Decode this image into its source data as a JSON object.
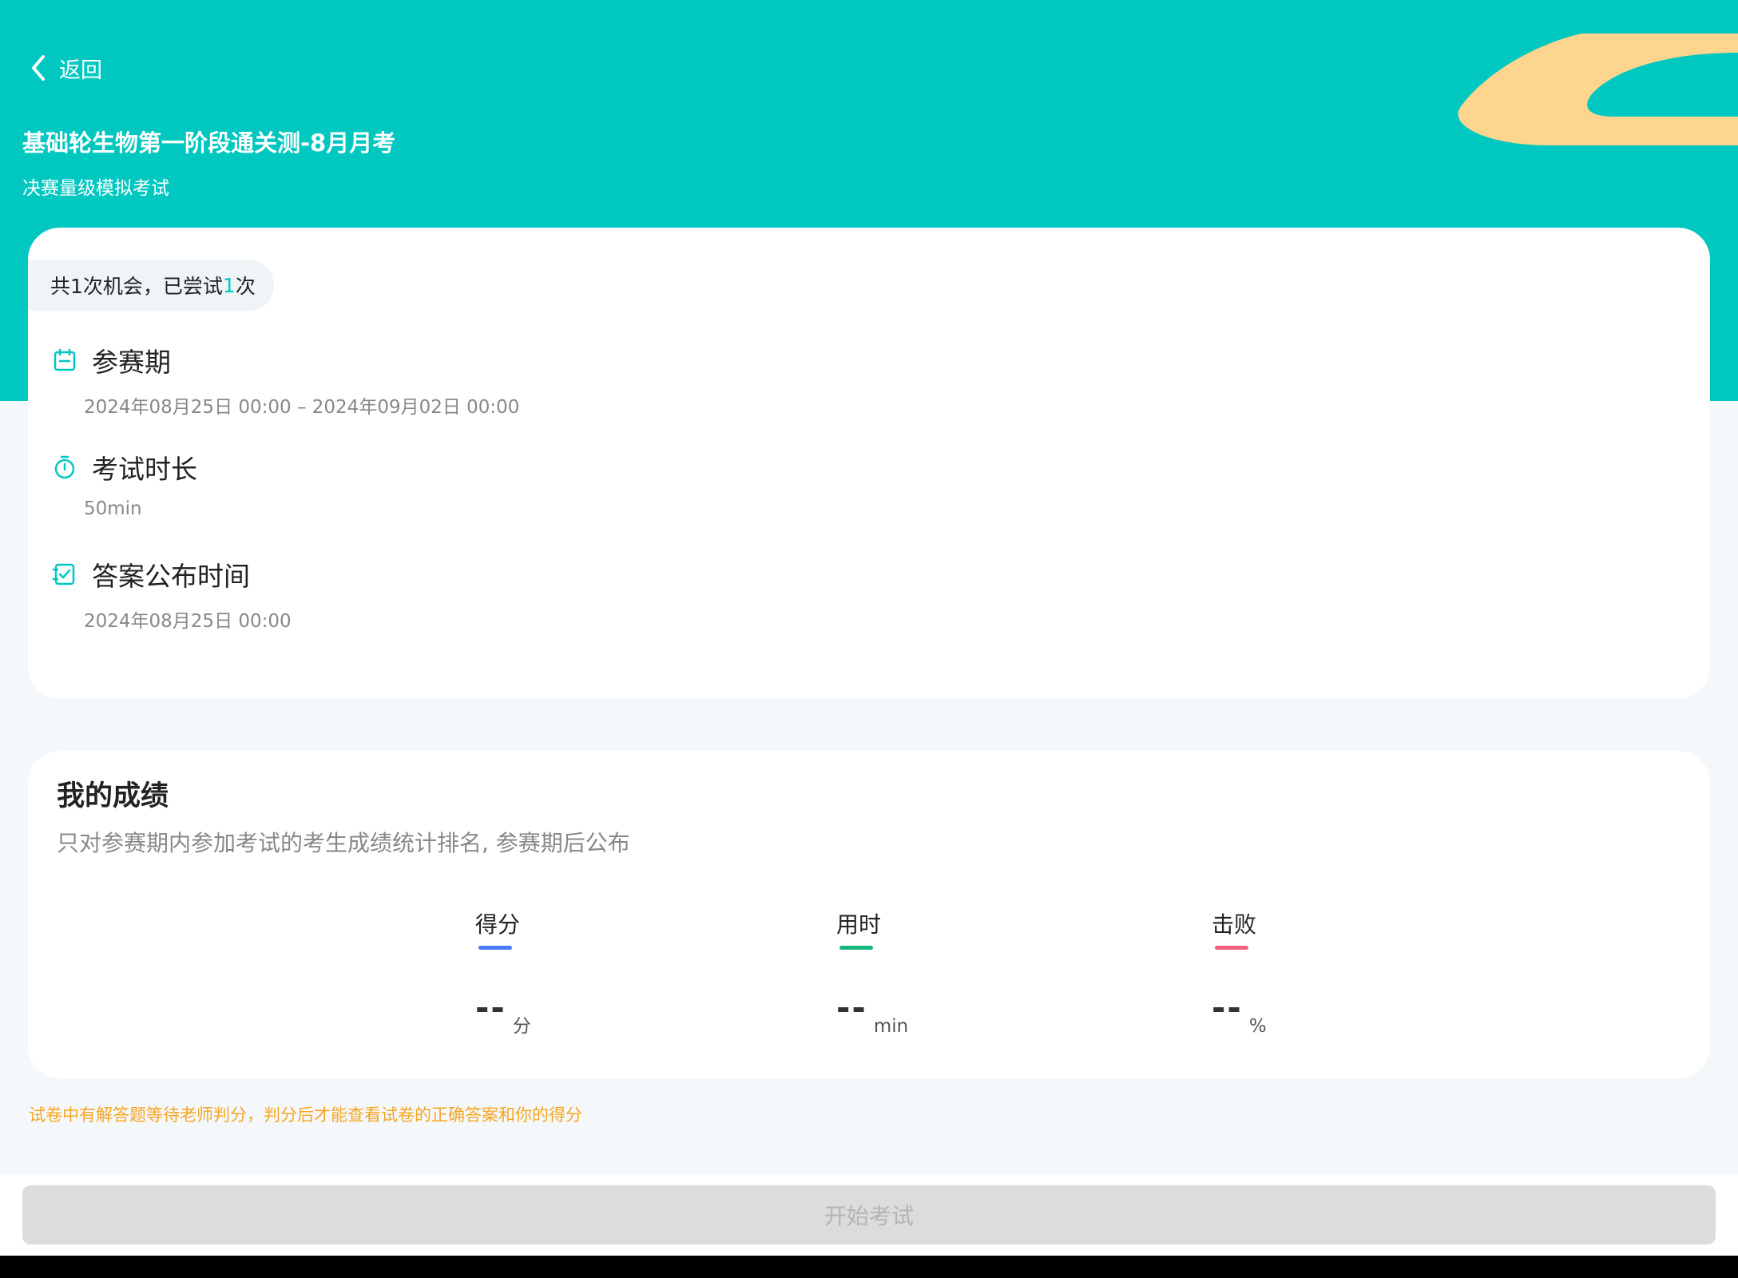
{
  "header": {
    "back_label": "返回",
    "title": "基础轮生物第一阶段通关测-8月月考",
    "subtitle": "决赛量级模拟考试"
  },
  "attempts": {
    "prefix": "共1次机会，已尝试",
    "count": "1",
    "suffix": "次"
  },
  "info": {
    "period_label": "参赛期",
    "period_value": "2024年08月25日 00:00  –  2024年09月02日 00:00",
    "duration_label": "考试时长",
    "duration_value": "50min",
    "answer_label": "答案公布时间",
    "answer_value": "2024年08月25日 00:00"
  },
  "score": {
    "title": "我的成绩",
    "description": "只对参赛期内参加考试的考生成绩统计排名, 参赛期后公布",
    "stats": [
      {
        "label": "得分",
        "value": "--",
        "unit": "分",
        "color": "#4a7bf7"
      },
      {
        "label": "用时",
        "value": "--",
        "unit": "min",
        "color": "#16b77a"
      },
      {
        "label": "击败",
        "value": "--",
        "unit": "%",
        "color": "#f0607f"
      }
    ]
  },
  "notice": "试卷中有解答题等待老师判分，判分后才能查看试卷的正确答案和你的得分",
  "start_button": "开始考试",
  "colors": {
    "accent": "#00c8c1",
    "deco": "#fdd58e",
    "warning": "#f5a623"
  }
}
